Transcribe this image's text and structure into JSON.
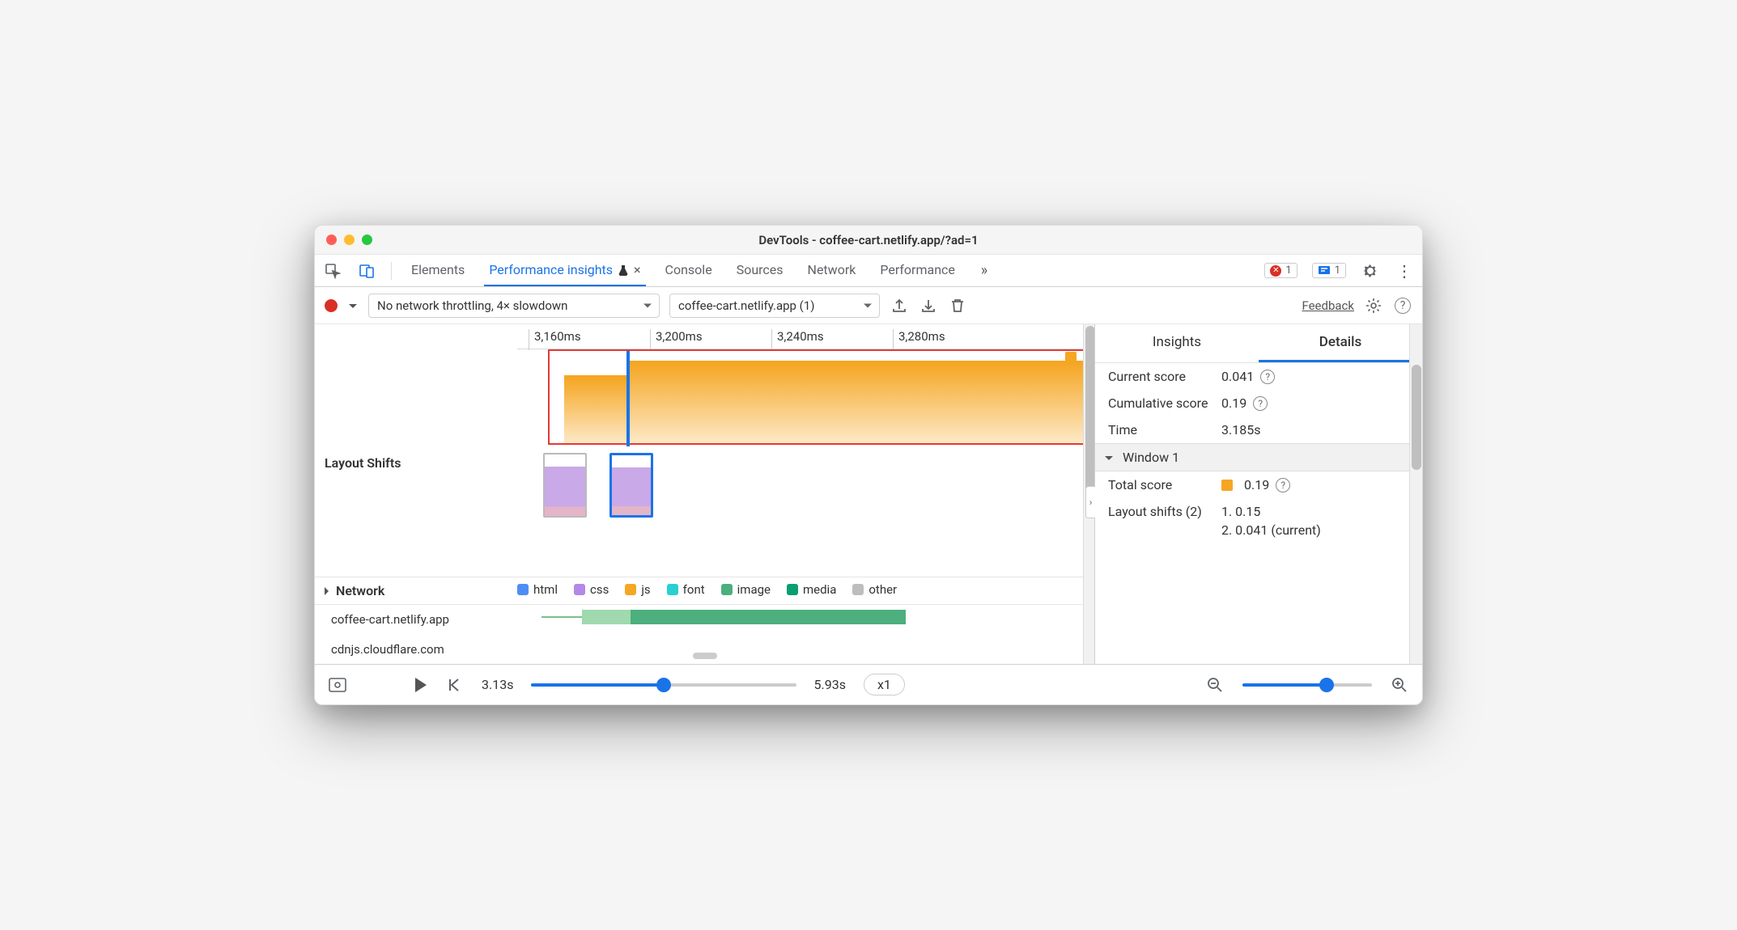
{
  "window_title": "DevTools - coffee-cart.netlify.app/?ad=1",
  "tabs": {
    "elements": "Elements",
    "perf_insights": "Performance insights",
    "console": "Console",
    "sources": "Sources",
    "network_tab": "Network",
    "performance": "Performance"
  },
  "error_badge": "1",
  "info_badge": "1",
  "toolbar": {
    "throttling": "No network throttling, 4× slowdown",
    "profile": "coffee-cart.netlify.app (1)",
    "feedback": "Feedback"
  },
  "ruler": {
    "t1": "3,160ms",
    "t2": "3,200ms",
    "t3": "3,240ms",
    "t4": "3,280ms"
  },
  "rows": {
    "layout_shifts": "Layout Shifts",
    "network": "Network",
    "host1": "coffee-cart.netlify.app",
    "host2": "cdnjs.cloudflare.com"
  },
  "legend": {
    "html": "html",
    "css": "css",
    "js": "js",
    "font": "font",
    "image": "image",
    "media": "media",
    "other": "other"
  },
  "legend_colors": {
    "html": "#4f8df5",
    "css": "#b388e8",
    "js": "#f5a623",
    "font": "#29d0d0",
    "image": "#4caf7d",
    "media": "#0a9e72",
    "other": "#bdbdbd"
  },
  "details": {
    "tab_insights": "Insights",
    "tab_details": "Details",
    "current_score_k": "Current score",
    "current_score_v": "0.041",
    "cumulative_score_k": "Cumulative score",
    "cumulative_score_v": "0.19",
    "time_k": "Time",
    "time_v": "3.185s",
    "window_hdr": "Window 1",
    "total_score_k": "Total score",
    "total_score_v": "0.19",
    "shifts_k": "Layout shifts (2)",
    "shift1": "1. 0.15",
    "shift2": "2. 0.041 (current)"
  },
  "footer": {
    "t_start": "3.13s",
    "t_end": "5.93s",
    "speed": "x1"
  }
}
